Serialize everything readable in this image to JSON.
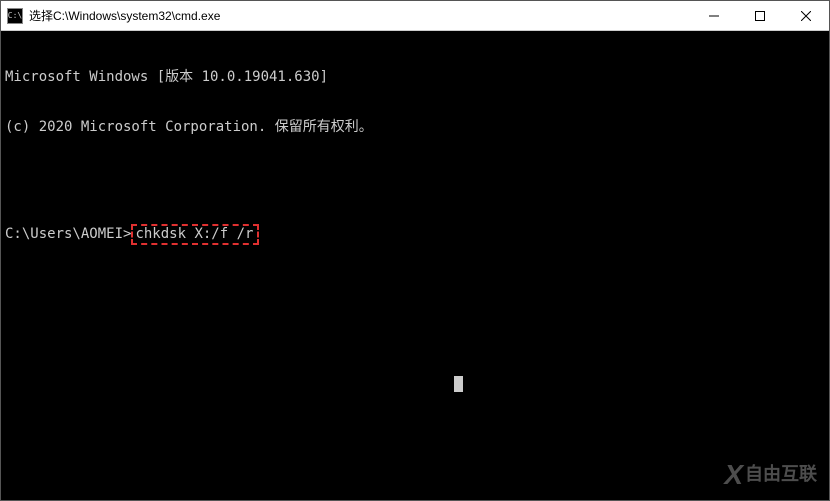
{
  "titlebar": {
    "icon_glyph": "C:\\",
    "title": "选择C:\\Windows\\system32\\cmd.exe"
  },
  "terminal": {
    "line1": "Microsoft Windows [版本 10.0.19041.630]",
    "line2": "(c) 2020 Microsoft Corporation. 保留所有权利。",
    "prompt": "C:\\Users\\AOMEI>",
    "command": "chkdsk X:/f /r"
  },
  "watermark": {
    "icon": "X",
    "text": "自由互联"
  }
}
